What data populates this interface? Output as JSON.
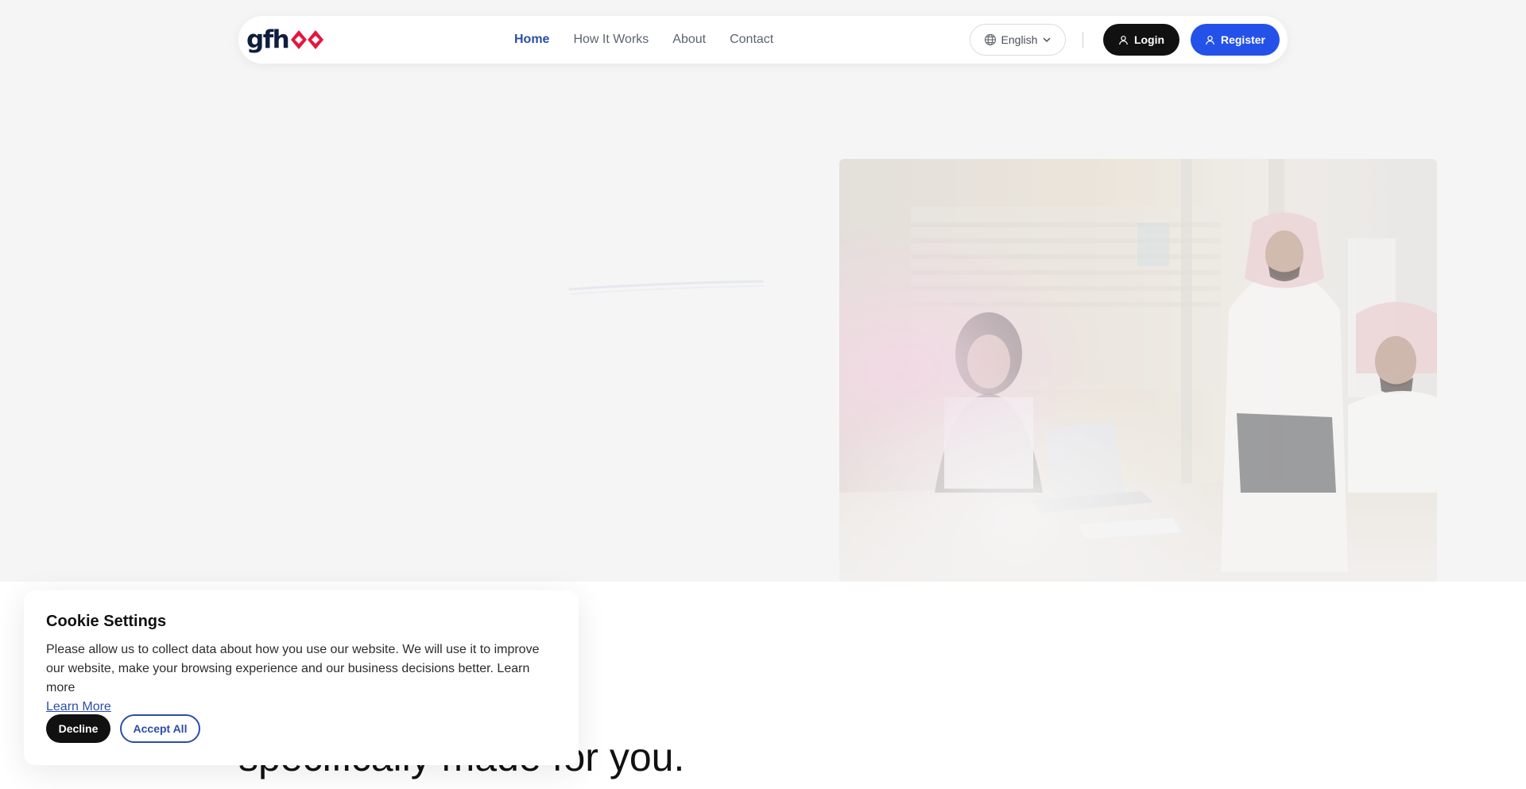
{
  "nav": {
    "logo_text": "gfh",
    "links": [
      {
        "label": "Home",
        "active": true
      },
      {
        "label": "How It Works",
        "active": false
      },
      {
        "label": "About",
        "active": false
      },
      {
        "label": "Contact",
        "active": false
      }
    ],
    "language": "English",
    "login_label": "Login",
    "register_label": "Register"
  },
  "hero": {
    "heading_partial": "specifically made for you."
  },
  "cookie": {
    "title": "Cookie Settings",
    "body": "Please allow us to collect data about how you use our website. We will use it to improve our website, make your browsing experience and our business decisions better. Learn more",
    "learn_more": "Learn More",
    "decline_label": "Decline",
    "accept_label": "Accept All"
  },
  "colors": {
    "brand_navy": "#0f1e3d",
    "brand_red": "#e3173e",
    "accent_blue": "#2452e8",
    "link_blue": "#2b4ea8",
    "hero_bg": "#f5f5f5"
  },
  "icons": [
    "globe-icon",
    "chevron-down-icon",
    "user-icon"
  ]
}
